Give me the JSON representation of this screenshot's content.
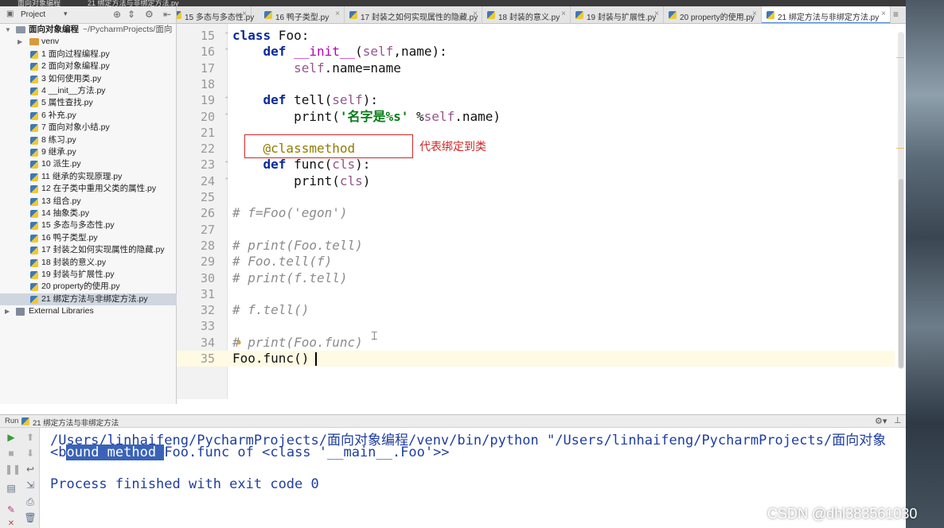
{
  "window": {
    "title_fragments": [
      "面向对象编程",
      "21 绑定方法与非绑定方法.py"
    ]
  },
  "project_bar": {
    "label": "Project"
  },
  "tabs": [
    {
      "label": "15 多态与多态性.py"
    },
    {
      "label": "16 鸭子类型.py"
    },
    {
      "label": "17 封装之如何实现属性的隐藏.py"
    },
    {
      "label": "18 封装的意义.py"
    },
    {
      "label": "19 封装与扩展性.py"
    },
    {
      "label": "20 property的使用.py"
    },
    {
      "label": "21 绑定方法与非绑定方法.py"
    }
  ],
  "tree": {
    "root": {
      "name": "面向对象编程",
      "path": "~/PycharmProjects/面向"
    },
    "venv": "venv",
    "files": [
      "1 面向过程编程.py",
      "2 面向对象编程.py",
      "3 如何使用类.py",
      "4 __init__方法.py",
      "5 属性查找.py",
      "6 补充.py",
      "7 面向对象小结.py",
      "8 练习.py",
      "9 继承.py",
      "10 派生.py",
      "11 继承的实现原理.py",
      "12 在子类中重用父类的属性.py",
      "13 组合.py",
      "14 抽象类.py",
      "15 多态与多态性.py",
      "16 鸭子类型.py",
      "17 封装之如何实现属性的隐藏.py",
      "18 封装的意义.py",
      "19 封装与扩展性.py",
      "20 property的使用.py",
      "21 绑定方法与非绑定方法.py"
    ],
    "external": "External Libraries"
  },
  "editor": {
    "line_numbers": [
      "15",
      "16",
      "17",
      "18",
      "19",
      "20",
      "21",
      "22",
      "23",
      "24",
      "25",
      "26",
      "27",
      "28",
      "29",
      "30",
      "31",
      "32",
      "33",
      "34",
      "35"
    ],
    "code": {
      "l15_kw": "class",
      "l15_rest": " Foo:",
      "l16_kw": "def",
      "l16_name": " __init__",
      "l16_p1": "(",
      "l16_self": "self",
      "l16_rest": ",name):",
      "l17_self": "self",
      "l17_rest": ".name=name",
      "l19_kw": "def",
      "l19_rest": " tell(",
      "l19_self": "self",
      "l19_end": "):",
      "l20_pre": "print(",
      "l20_str": "'名字是%s'",
      "l20_mid": " %",
      "l20_self": "self",
      "l20_end": ".name)",
      "l22": "@classmethod",
      "l23_kw": "def",
      "l23_rest": " func(",
      "l23_cls": "cls",
      "l23_end": "):",
      "l24_pre": "print(",
      "l24_cls": "cls",
      "l24_end": ")",
      "l26": "# f=Foo('egon')",
      "l28": "# print(Foo.tell)",
      "l29": "# Foo.tell(f)",
      "l30": "# print(f.tell)",
      "l32": "# f.tell()",
      "l34": "# print(Foo.func)",
      "l35": "Foo.func()"
    },
    "annotation": "代表绑定到类"
  },
  "run": {
    "tab_label": "Run",
    "config": "21 绑定方法与非绑定方法",
    "output": {
      "line1": "/Users/linhaifeng/PycharmProjects/面向对象编程/venv/bin/python \"/Users/linhaifeng/PycharmProjects/面向对象",
      "line2_a": "<b",
      "line2_hl": "ound method ",
      "line2_b": "Foo.func of <class '__main__.Foo'>>",
      "line3": "Process finished with exit code 0"
    }
  },
  "watermark": "CSDN @dhl383561030",
  "colors": {
    "annotation_red": "#d02525",
    "keyword_blue": "#0b2a9b",
    "self_purple": "#94558d",
    "string_green": "#067d17",
    "console_blue": "#1f3ea0",
    "selection_blue": "#3a63b8"
  }
}
